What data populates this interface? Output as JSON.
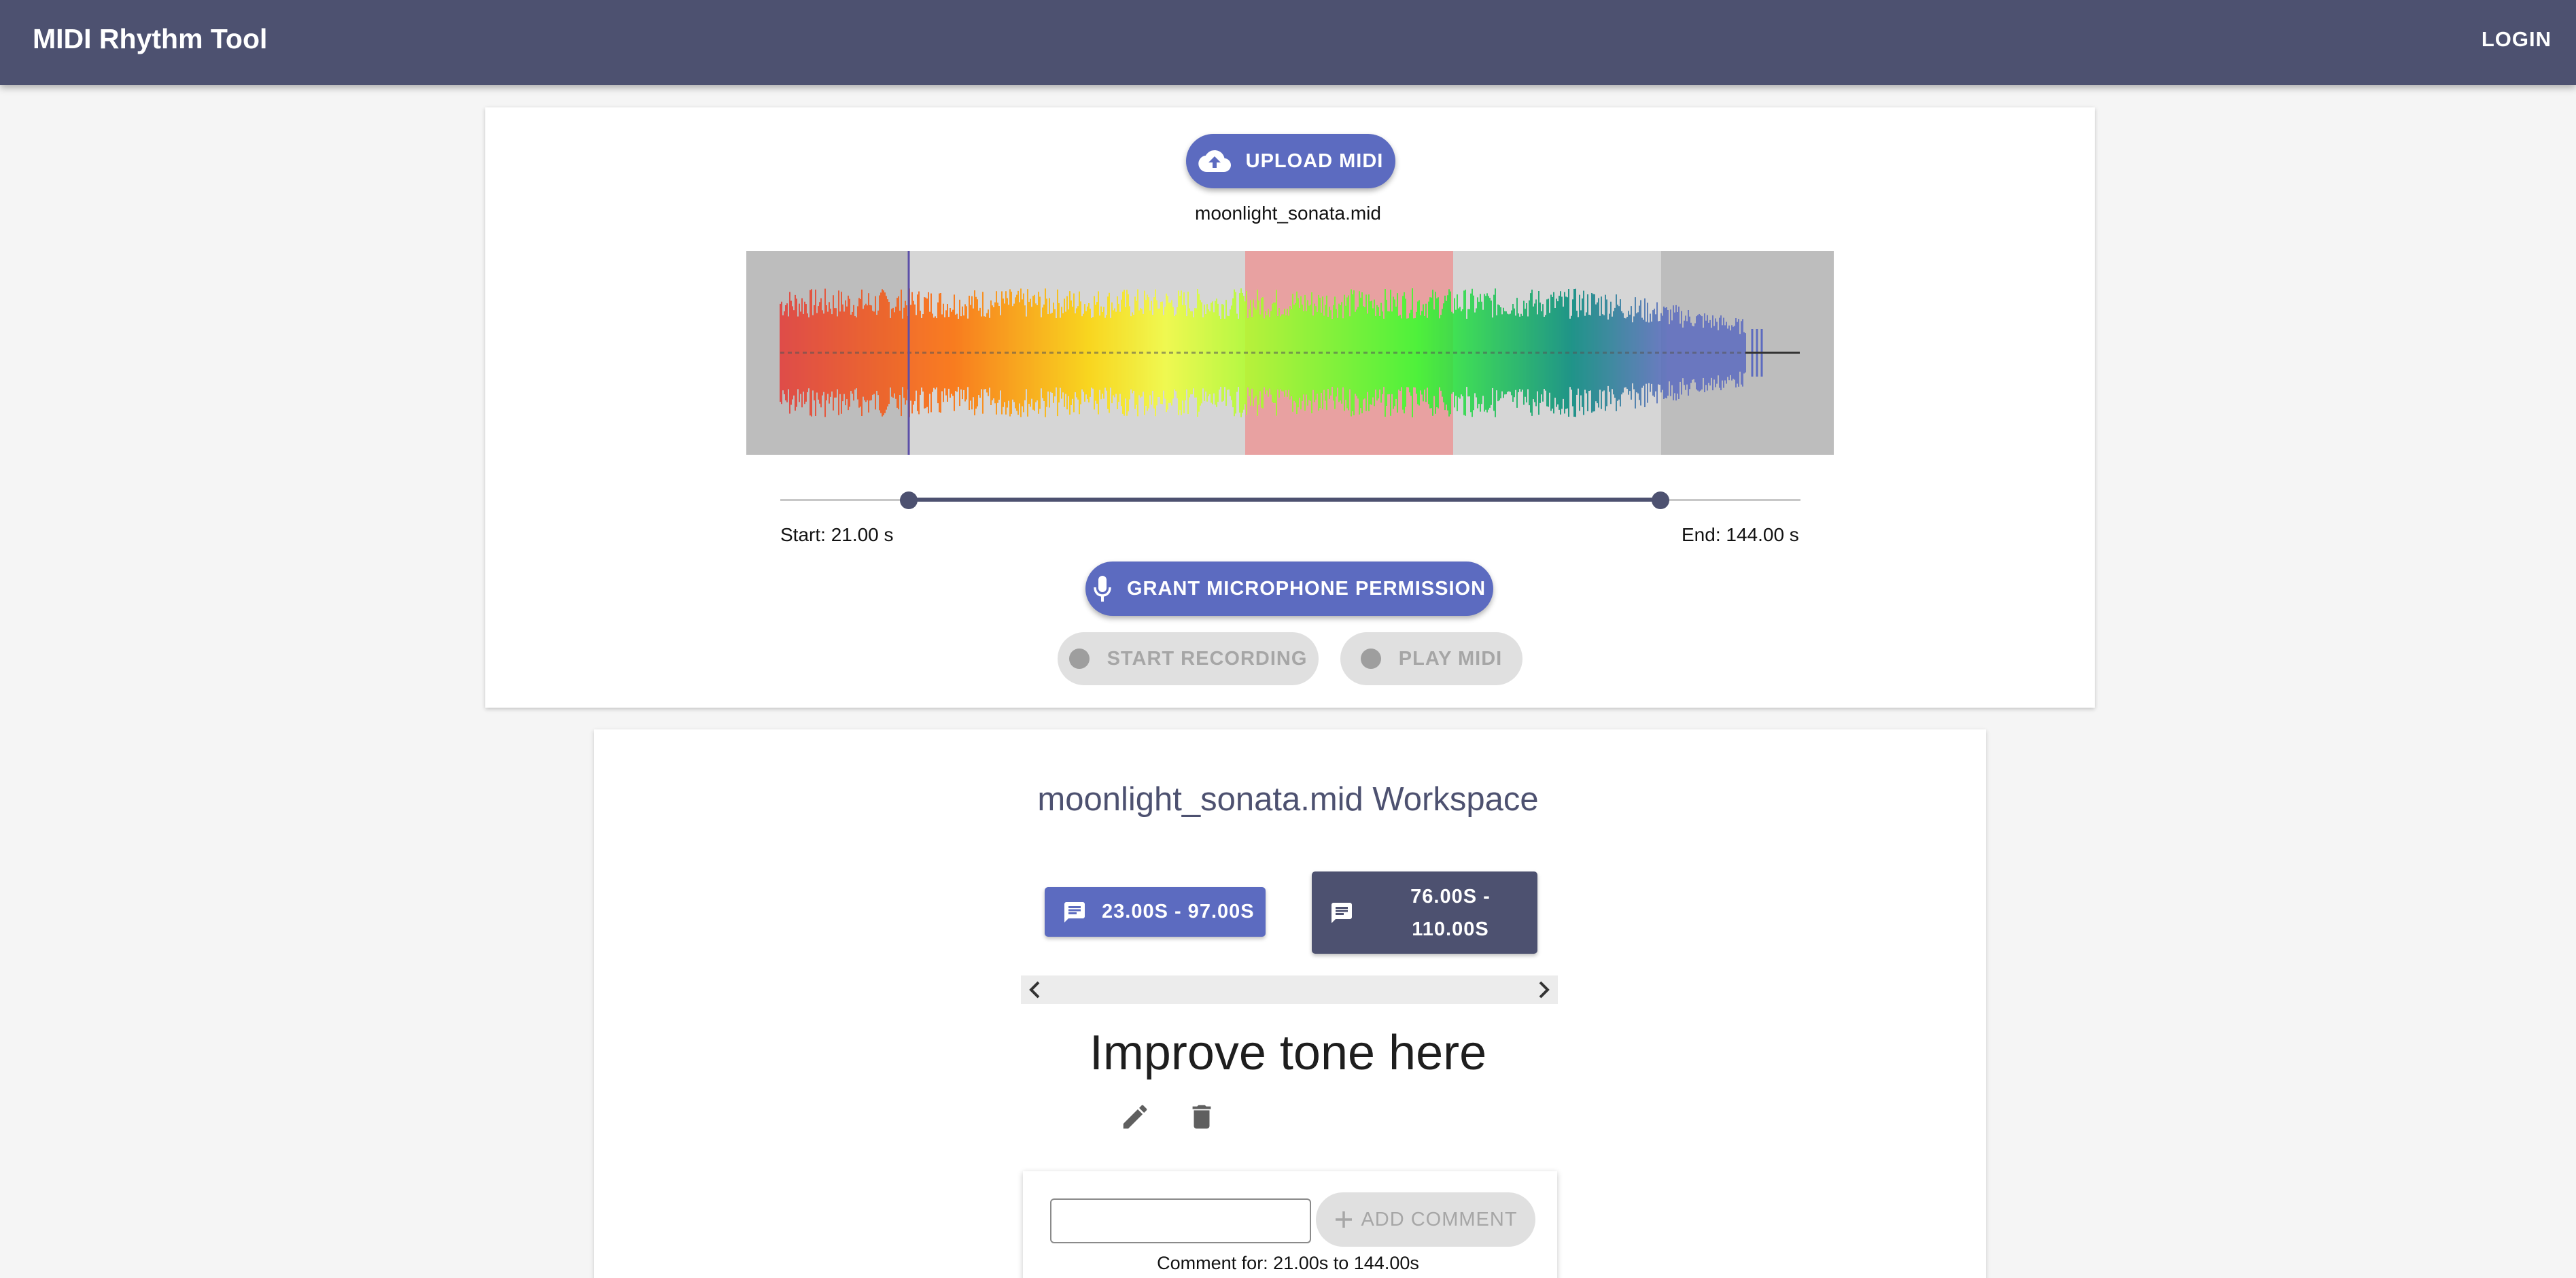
{
  "appbar": {
    "title": "MIDI Rhythm Tool",
    "login_label": "LOGIN"
  },
  "upload": {
    "upload_label": "UPLOAD MIDI",
    "filename": "moonlight_sonata.mid",
    "start_label": "Start: 21.00 s",
    "end_label": "End: 144.00 s",
    "mic_label": "GRANT MICROPHONE PERMISSION",
    "record_label": "START RECORDING",
    "play_label": "PLAY MIDI"
  },
  "workspace": {
    "title": "moonlight_sonata.mid Workspace",
    "ranges": [
      {
        "label": "23.00S - 97.00S"
      },
      {
        "label_line1": "76.00S -",
        "label_line2": "110.00S"
      }
    ],
    "comment_heading": "Improve tone here",
    "comment_input_value": "",
    "add_label": "ADD COMMENT",
    "comment_for": "Comment for: 21.00s to 144.00s"
  },
  "colors": {
    "appbar": "#4d5170",
    "primary": "#5c6bc0",
    "selected_range": "#4d5170",
    "disabled": "#e0e0e0"
  },
  "icons": {
    "upload": "cloud-upload-icon",
    "mic": "microphone-icon",
    "record": "record-dot-icon",
    "play": "play-dot-icon",
    "comment": "comment-icon",
    "edit": "pencil-icon",
    "delete": "trash-icon",
    "add": "plus-icon",
    "scroll_left": "chevron-left-icon",
    "scroll_right": "chevron-right-icon"
  }
}
